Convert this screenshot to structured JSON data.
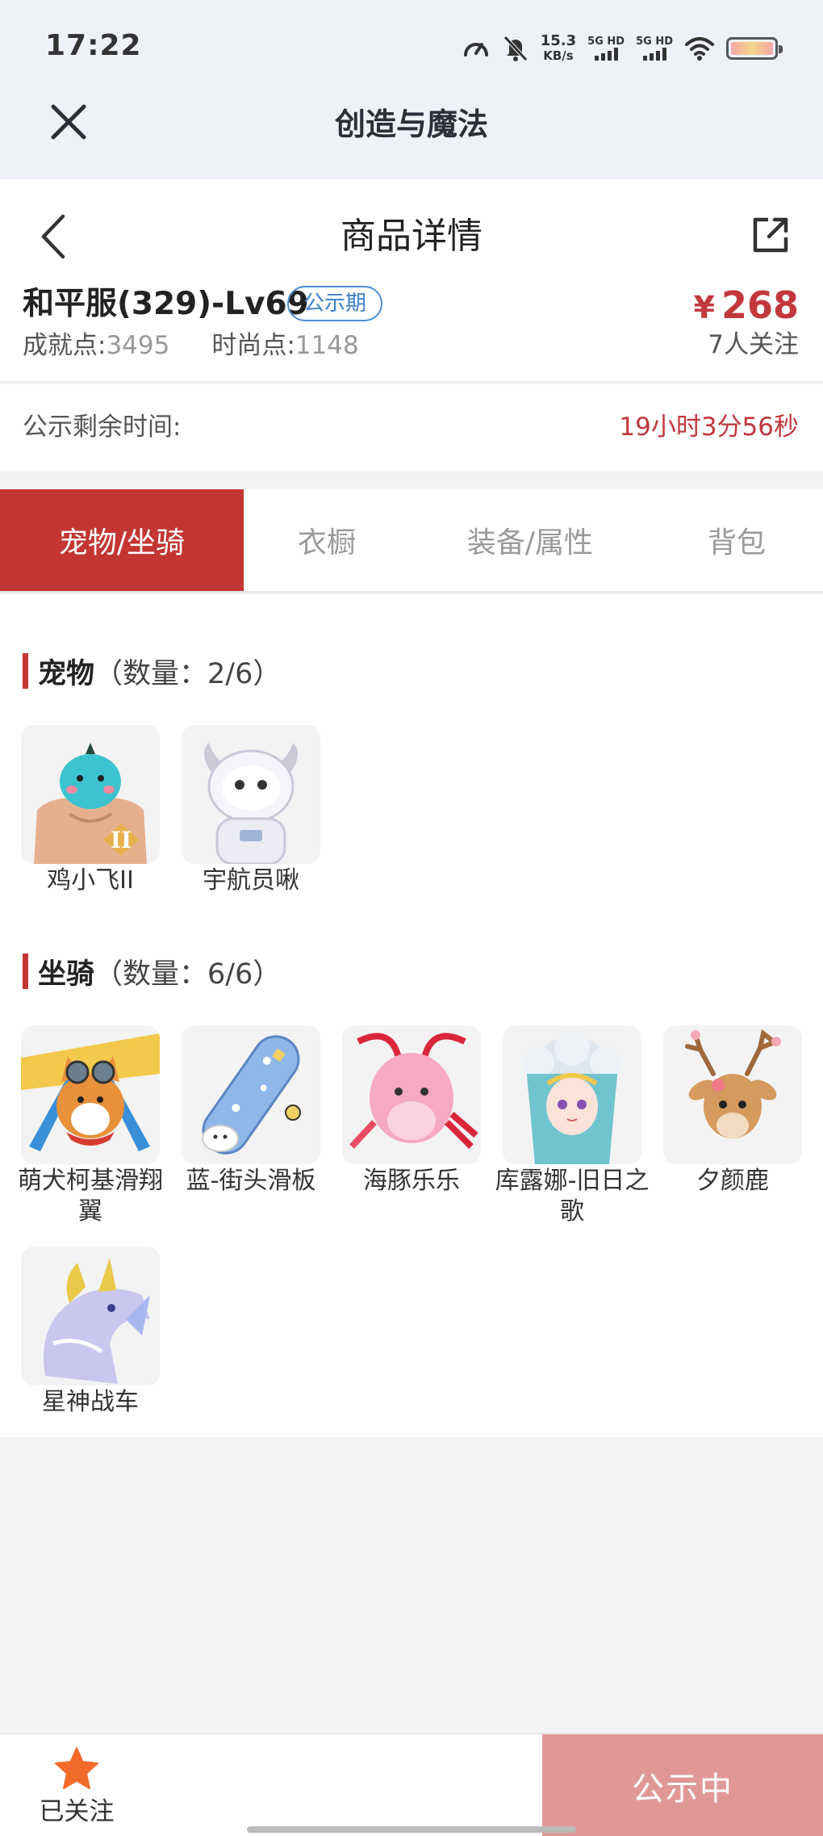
{
  "status_bar": {
    "time": "17:22",
    "net_speed_value": "15.3",
    "net_speed_unit": "KB/s",
    "sim1_label": "5G HD",
    "sim2_label": "5G HD",
    "icons": [
      "speedometer-icon",
      "bell-muted-icon",
      "wifi-icon",
      "battery-icon"
    ]
  },
  "mini_program": {
    "title": "创造与魔法",
    "close_icon": "close-icon"
  },
  "page_header": {
    "title": "商品详情",
    "back_icon": "chevron-left-icon",
    "share_icon": "share-external-icon"
  },
  "product": {
    "name": "和平服(329)-Lv69",
    "badge": "公示期",
    "achievement_label": "成就点:",
    "achievement_value": "3495",
    "fashion_label": "时尚点:",
    "fashion_value": "1148",
    "currency": "¥",
    "price": "268",
    "followers": "7人关注"
  },
  "countdown": {
    "label": "公示剩余时间:",
    "value": "19小时3分56秒"
  },
  "tabs": [
    {
      "label": "宠物/坐骑",
      "active": true
    },
    {
      "label": "衣橱",
      "active": false
    },
    {
      "label": "装备/属性",
      "active": false
    },
    {
      "label": "背包",
      "active": false
    }
  ],
  "pets": {
    "title": "宠物",
    "count": "（数量：2/6）",
    "items": [
      {
        "name": "鸡小飞II",
        "icon": "pet-chick-icon"
      },
      {
        "name": "宇航员啾",
        "icon": "pet-astronaut-icon"
      }
    ]
  },
  "mounts": {
    "title": "坐骑",
    "count": "（数量：6/6）",
    "items": [
      {
        "name": "萌犬柯基滑翔翼",
        "icon": "mount-corgi-glider-icon"
      },
      {
        "name": "蓝-街头滑板",
        "icon": "mount-skateboard-icon"
      },
      {
        "name": "海豚乐乐",
        "icon": "mount-dolphin-icon"
      },
      {
        "name": "库露娜-旧日之歌",
        "icon": "mount-kuluna-icon"
      },
      {
        "name": "夕颜鹿",
        "icon": "mount-deer-icon"
      },
      {
        "name": "星神战车",
        "icon": "mount-star-chariot-icon"
      }
    ]
  },
  "bottom_bar": {
    "follow_label": "已关注",
    "action_label": "公示中",
    "colors": {
      "star": "#f26a2a",
      "action_bg": "#e09896"
    }
  },
  "colors": {
    "accent": "#c33633",
    "badge": "#3a7fce",
    "page_bg": "#f3f3f4"
  }
}
